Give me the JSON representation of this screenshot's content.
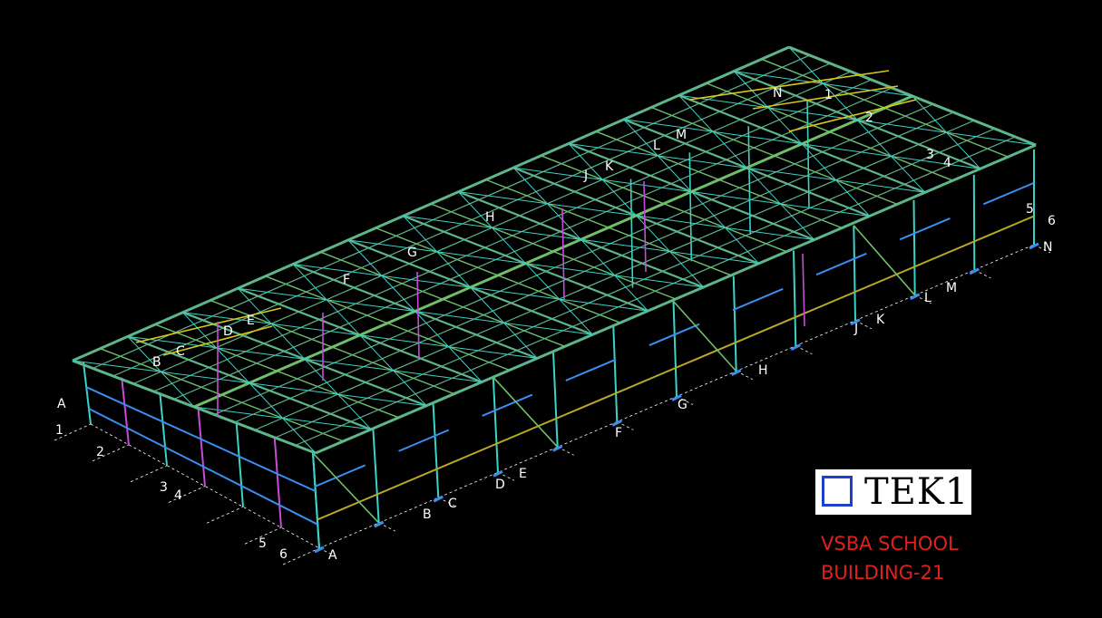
{
  "colors": {
    "background": "#000000",
    "truss": "#5fb58a",
    "rafter": "#6fbf6a",
    "column": "#3ad3c8",
    "beam": "#3a8ef0",
    "brace": "#c84bd8",
    "ridge": "#d8c81a",
    "girt": "#b8a822",
    "grid": "#ffffff",
    "caption": "#e0201c",
    "logo_square": "#1f3fcf"
  },
  "grid_labels": {
    "front_letters": [
      "A",
      "B",
      "C",
      "D",
      "E",
      "F",
      "G",
      "H",
      "J",
      "K",
      "L",
      "M",
      "N"
    ],
    "left_numbers": [
      "A",
      "1",
      "2",
      "3",
      "4",
      "5",
      "6"
    ],
    "right_numbers": [
      "3",
      "4",
      "5",
      "6",
      "N"
    ],
    "top_letters": [
      "B",
      "C",
      "D",
      "E",
      "F",
      "G",
      "H",
      "J",
      "K",
      "L",
      "M",
      "N"
    ],
    "top_numbers": [
      "1",
      "2"
    ]
  },
  "logo": {
    "text": "TEK1",
    "square_icon": "square-outline-icon"
  },
  "caption": {
    "line1": "VSBA SCHOOL",
    "line2": "BUILDING-21"
  }
}
